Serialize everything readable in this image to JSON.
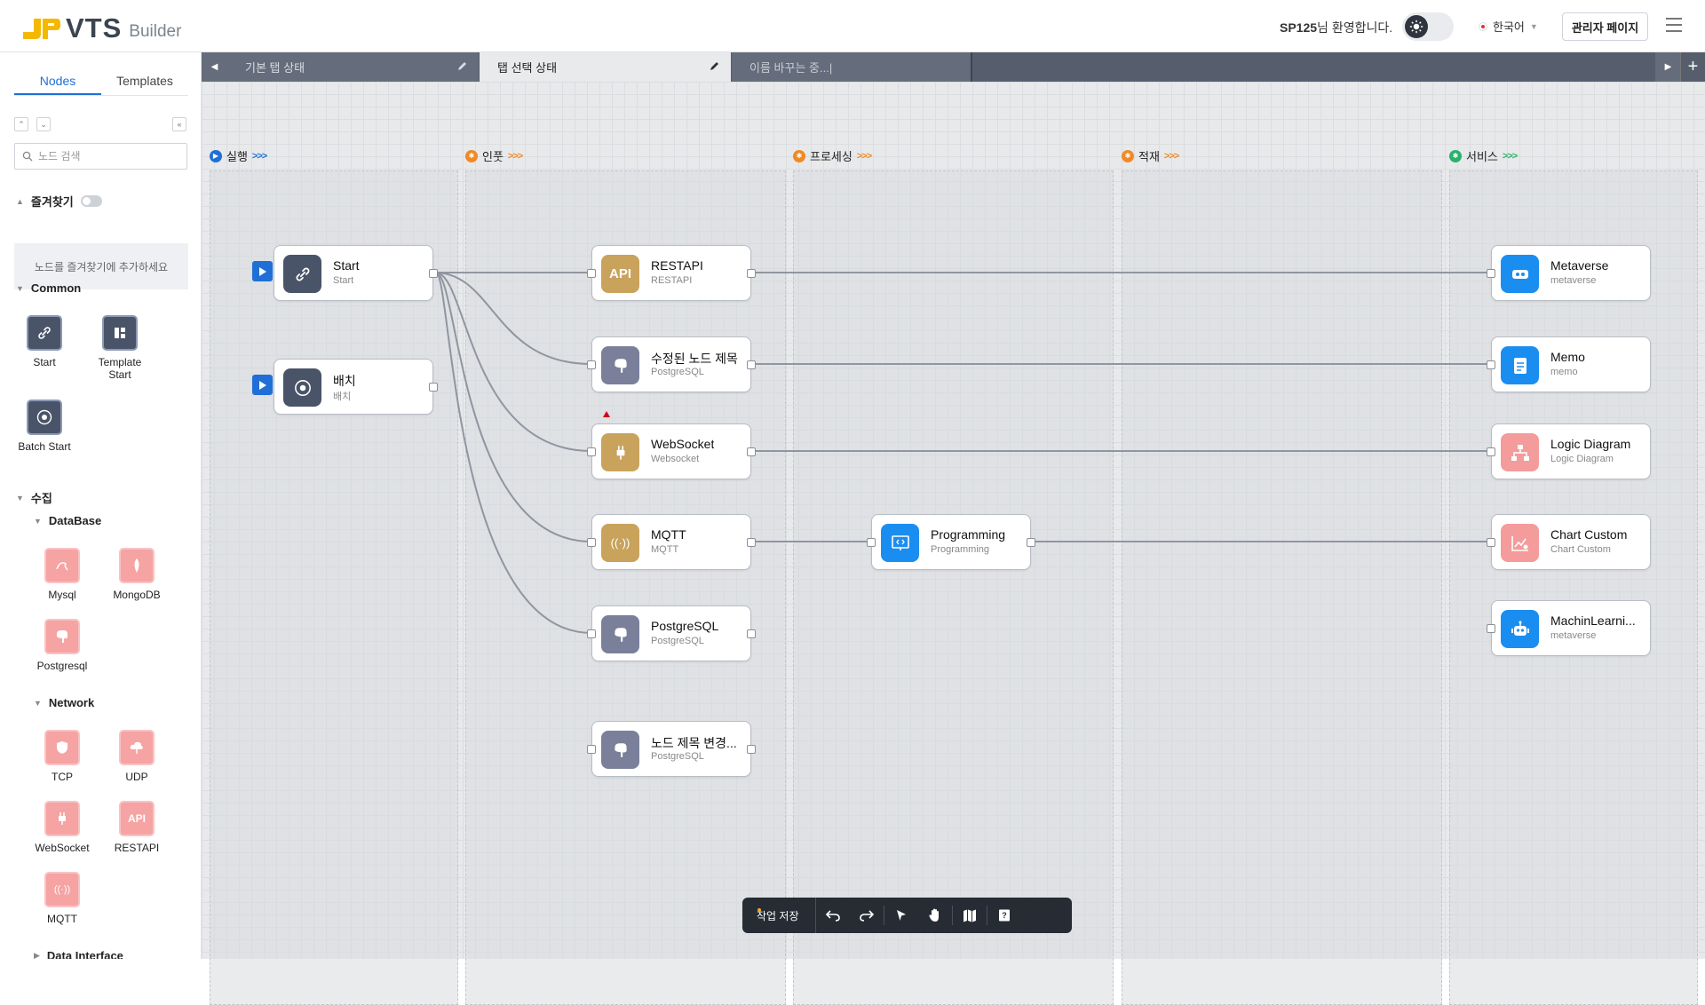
{
  "app": {
    "brand": "VTS",
    "sub": "Builder",
    "welcome_user": "SP125",
    "welcome_suffix": "님 환영합니다.",
    "language": "한국어",
    "admin_label": "관리자 페이지"
  },
  "sidebar": {
    "tabs": [
      "Nodes",
      "Templates"
    ],
    "search_placeholder": "노드 검색",
    "favorites_title": "즐겨찾기",
    "favorites_empty": "노드를 즐겨찾기에 추가하세요",
    "common_title": "Common",
    "common_items": [
      "Start",
      "Template Start",
      "Batch Start"
    ],
    "collect_title": "수집",
    "database_title": "DataBase",
    "database_items": [
      "Mysql",
      "MongoDB",
      "Postgresql"
    ],
    "network_title": "Network",
    "network_items": [
      "TCP",
      "UDP",
      "WebSocket",
      "RESTAPI",
      "MQTT"
    ],
    "data_interface_title": "Data Interface"
  },
  "canvas": {
    "tabs": [
      {
        "label": "기본 탭 상태"
      },
      {
        "label": "탭 선택 상태"
      },
      {
        "label": "이름 바꾸는 중...|"
      }
    ],
    "columns": [
      {
        "label": "실행",
        "color": "#1f6fd6"
      },
      {
        "label": "인풋",
        "color": "#f08a24"
      },
      {
        "label": "프로세싱",
        "color": "#f08a24"
      },
      {
        "label": "적재",
        "color": "#f08a24"
      },
      {
        "label": "서비스",
        "color": "#27b36a"
      }
    ],
    "nodes": {
      "start": {
        "title": "Start",
        "sub": "Start"
      },
      "batch": {
        "title": "배치",
        "sub": "배치"
      },
      "restapi": {
        "title": "RESTAPI",
        "sub": "RESTAPI",
        "icon_text": "API"
      },
      "pg_edited": {
        "title": "수정된 노드 제목",
        "sub": "PostgreSQL"
      },
      "websocket": {
        "title": "WebSocket",
        "sub": "Websocket"
      },
      "mqtt": {
        "title": "MQTT",
        "sub": "MQTT"
      },
      "postgres": {
        "title": "PostgreSQL",
        "sub": "PostgreSQL"
      },
      "pg_rename": {
        "title": "노드 제목 변경...",
        "sub": "PostgreSQL"
      },
      "programming": {
        "title": "Programming",
        "sub": "Programming"
      },
      "metaverse": {
        "title": "Metaverse",
        "sub": "metaverse"
      },
      "memo": {
        "title": "Memo",
        "sub": "memo"
      },
      "logic": {
        "title": "Logic Diagram",
        "sub": "Logic Diagram"
      },
      "chart": {
        "title": "Chart Custom",
        "sub": "Chart Custom"
      },
      "ml": {
        "title": "MachinLearni...",
        "sub": "metaverse"
      }
    },
    "toolbar": {
      "save_label": "작업 저장"
    }
  },
  "colors": {
    "accent": "#1f6fd6",
    "node_dark": "#4a5468",
    "node_gold": "#c9a25c",
    "node_purple": "#7a7f9a",
    "node_blue": "#1a8ef0",
    "node_pink": "#f49b9b"
  }
}
